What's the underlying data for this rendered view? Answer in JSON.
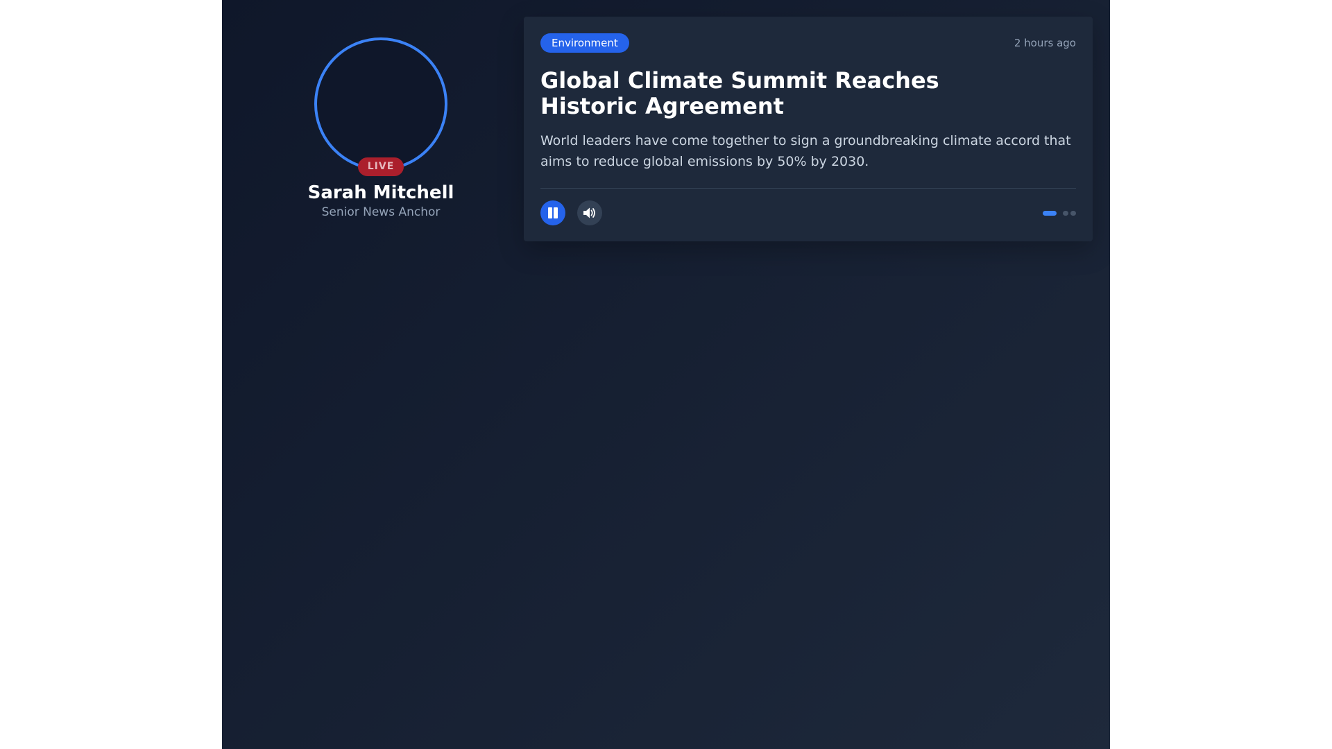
{
  "anchor": {
    "name": "Sarah Mitchell",
    "role": "Senior News Anchor",
    "live_label": "LIVE",
    "avatar_ring_color": "#3b82f6",
    "live_color": "#ab1f2c"
  },
  "story": {
    "category": "Environment",
    "timestamp": "2 hours ago",
    "headline": "Global Climate Summit Reaches Historic Agreement",
    "summary": "World leaders have come together to sign a groundbreaking climate accord that aims to reduce global emissions by 50% by 2030."
  },
  "controls": {
    "play_state_icon": "pause-icon",
    "volume_icon": "volume-icon",
    "accent_color": "#2563eb"
  },
  "pager": {
    "total": 3,
    "active": 1
  },
  "colors": {
    "background": "#0f172a",
    "card": "#1e293b",
    "muted_text": "#94a3b8"
  }
}
